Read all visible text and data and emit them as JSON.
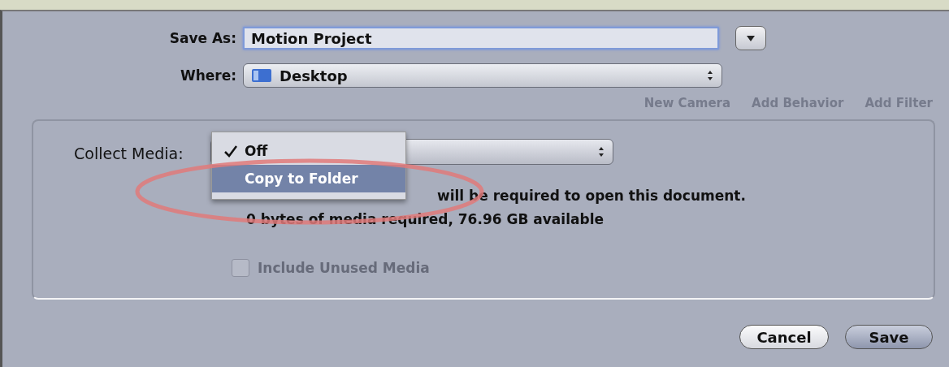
{
  "background_toolbar": {
    "items": [
      "New Camera",
      "Add Behavior",
      "Add Filter"
    ]
  },
  "save_as": {
    "label": "Save As:",
    "value": "Motion Project"
  },
  "where": {
    "label": "Where:",
    "value": "Desktop"
  },
  "collect_media": {
    "label": "Collect Media:",
    "menu": [
      {
        "label": "Off",
        "checked": true,
        "selected": false
      },
      {
        "label": "Copy to Folder",
        "checked": false,
        "selected": true
      }
    ]
  },
  "info_lines": [
    "will be required to open this document.",
    "0 bytes of media required, 76.96 GB available"
  ],
  "include_unused": {
    "label": "Include Unused Media",
    "checked": false,
    "disabled": true
  },
  "buttons": [
    {
      "label": "Cancel",
      "kind": "secondary"
    },
    {
      "label": "Save",
      "kind": "default"
    }
  ]
}
